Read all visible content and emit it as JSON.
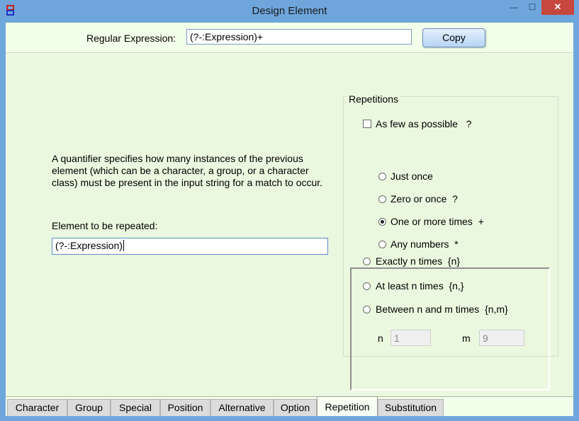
{
  "window": {
    "title": "Design Element",
    "close_glyph": "✕",
    "min_glyph": "—",
    "max_glyph": "☐"
  },
  "top": {
    "regex_label": "Regular Expression:",
    "regex_value": "(?-:Expression)+",
    "copy_label": "Copy"
  },
  "description": "A quantifier specifies how many instances of the previous element (which can be a character, a group, or a character class) must be present in the input string for a match to occur.",
  "element": {
    "label": "Element to be repeated:",
    "value": "(?-:Expression)"
  },
  "repetitions": {
    "legend": "Repetitions",
    "few_label": "As few as possible",
    "few_symbol": "?",
    "few_checked": false,
    "options": [
      {
        "label": "Just once",
        "symbol": "",
        "selected": false
      },
      {
        "label": "Zero or once",
        "symbol": "?",
        "selected": false
      },
      {
        "label": "One or more times",
        "symbol": "+",
        "selected": true
      },
      {
        "label": "Any numbers",
        "symbol": "*",
        "selected": false
      }
    ],
    "count_options": [
      {
        "label": "Exactly n times",
        "symbol": "{n}",
        "selected": false
      },
      {
        "label": "At least n times",
        "symbol": "{n,}",
        "selected": false
      },
      {
        "label": "Between n and m times",
        "symbol": "{n,m}",
        "selected": false
      }
    ],
    "n_label": "n",
    "n_value": "1",
    "m_label": "m",
    "m_value": "9"
  },
  "tabs": [
    "Character",
    "Group",
    "Special",
    "Position",
    "Alternative",
    "Option",
    "Repetition",
    "Substitution"
  ],
  "active_tab": "Repetition",
  "colors": {
    "titlebar": "#6ea6dc",
    "panel": "#eaf8df",
    "close": "#c7463d"
  },
  "icons": {
    "app": "app-icon"
  }
}
